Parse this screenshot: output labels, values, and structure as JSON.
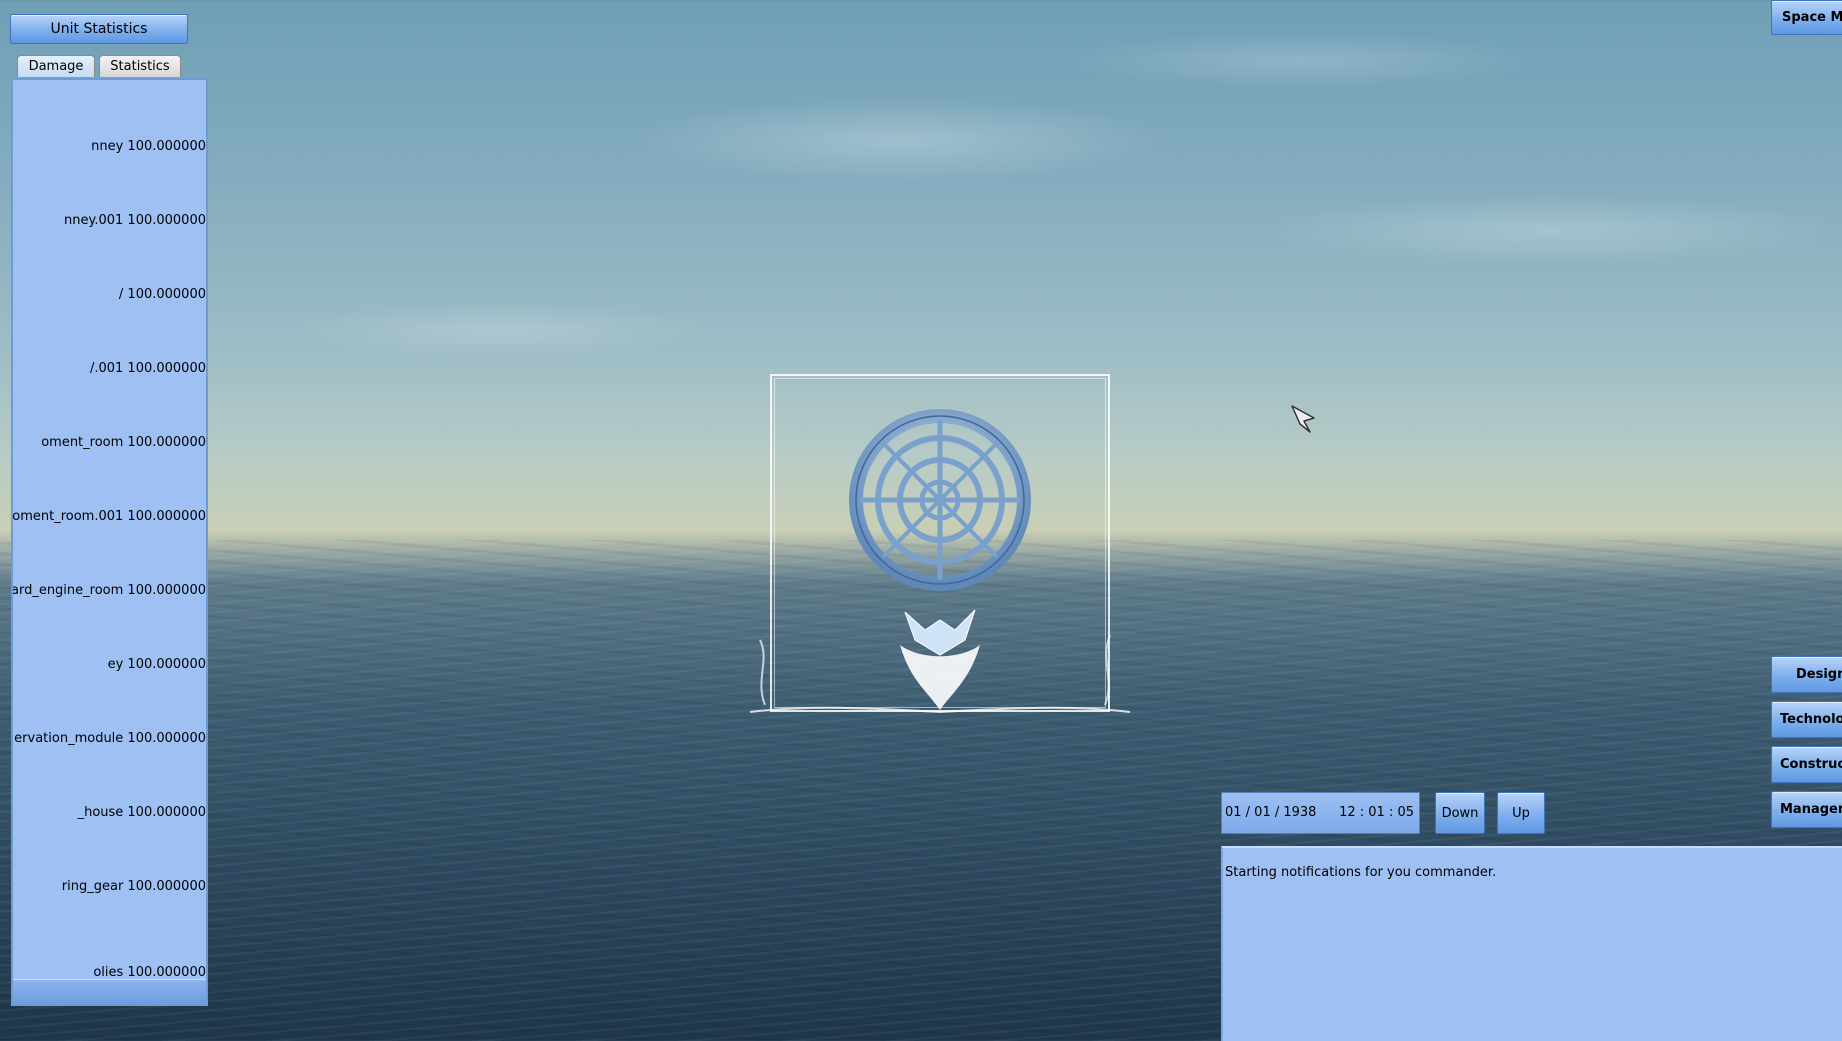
{
  "left_panel": {
    "title": "Unit Statistics",
    "tabs": [
      {
        "label": "Damage"
      },
      {
        "label": "Statistics"
      }
    ],
    "damage_rows": [
      {
        "label": "nney 100.000000"
      },
      {
        "label": "nney.001 100.000000"
      },
      {
        "label": "/ 100.000000"
      },
      {
        "label": "/.001 100.000000"
      },
      {
        "label": "oment_room 100.000000"
      },
      {
        "label": "oment_room.001 100.000000"
      },
      {
        "label": "ard_engine_room 100.000000"
      },
      {
        "label": "ey 100.000000"
      },
      {
        "label": "ervation_module 100.000000"
      },
      {
        "label": "_house 100.000000"
      },
      {
        "label": "ring_gear 100.000000"
      },
      {
        "label": "olies 100.000000"
      }
    ]
  },
  "right_menu": {
    "top_button": "Space Ma",
    "buttons": [
      {
        "label": "Design"
      },
      {
        "label": "Technolog"
      },
      {
        "label": "Constructi"
      },
      {
        "label": "Manageme"
      }
    ]
  },
  "time_bar": {
    "date": "01 / 01 / 1938",
    "time": "12 : 01 : 05",
    "down_label": "Down",
    "up_label": "Up"
  },
  "notifications": {
    "message": "Starting notifications for you commander."
  },
  "icons": {
    "emblem": "targeting-reticle-icon",
    "cursor": "mouse-cursor-icon"
  },
  "colors": {
    "panel": "#9fc0f3",
    "button": "#7fb0ee",
    "sky": "#86adbf",
    "sea": "#2c475d"
  }
}
